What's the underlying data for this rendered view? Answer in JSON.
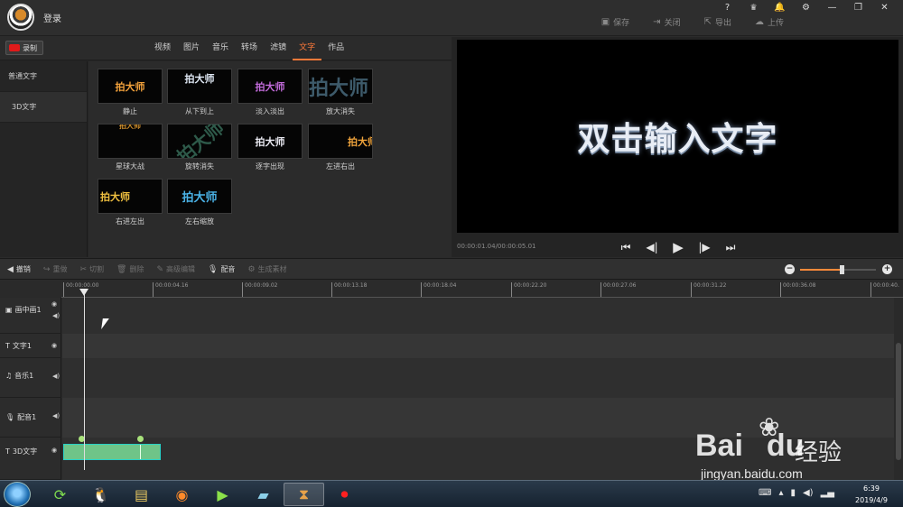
{
  "title_bar": {
    "login": "登录",
    "actions": [
      {
        "icon": "save-icon",
        "label": "保存"
      },
      {
        "icon": "close-doc-icon",
        "label": "关闭"
      },
      {
        "icon": "export-icon",
        "label": "导出"
      },
      {
        "icon": "upload-icon",
        "label": "上传"
      }
    ],
    "window_controls": [
      "?",
      "VIP",
      "🔔",
      "⚙",
      "—",
      "❐",
      "✕"
    ]
  },
  "library": {
    "record_label": "录制",
    "tabs": [
      "视频",
      "图片",
      "音乐",
      "转场",
      "滤镜",
      "文字",
      "作品"
    ],
    "active_tab": "文字",
    "categories": [
      "普通文字",
      "3D文字"
    ],
    "thumb_text": "拍大师",
    "thumbnails": [
      {
        "label": "静止",
        "color": "#f2a13b"
      },
      {
        "label": "从下到上",
        "color": "#dfe8f4"
      },
      {
        "label": "淡入淡出",
        "color": "#c06ad8"
      },
      {
        "label": "放大消失",
        "color": "#3d5a6a"
      },
      {
        "label": "星球大战",
        "color": "#d8942c"
      },
      {
        "label": "旋转消失",
        "color": "#2e5a4a"
      },
      {
        "label": "逐字出现",
        "color": "#e8e8f0"
      },
      {
        "label": "左进右出",
        "color": "#f0a43c"
      },
      {
        "label": "右进左出",
        "color": "#f0c040"
      },
      {
        "label": "左右缩放",
        "color": "#4ab2e6"
      }
    ]
  },
  "preview": {
    "text": "双击输入文字",
    "timecode": "00:00:01.04/00:00:05.01"
  },
  "edit_toolbar": {
    "tools": [
      {
        "icon": "undo-icon",
        "label": "撤销",
        "enabled": true
      },
      {
        "icon": "redo-icon",
        "label": "重做",
        "enabled": false
      },
      {
        "icon": "cut-icon",
        "label": "切割",
        "enabled": false
      },
      {
        "icon": "delete-icon",
        "label": "删除",
        "enabled": false
      },
      {
        "icon": "edit-icon",
        "label": "高级编辑",
        "enabled": false
      },
      {
        "icon": "mic-icon",
        "label": "配音",
        "enabled": true
      },
      {
        "icon": "generate-icon",
        "label": "生成素材",
        "enabled": false
      }
    ],
    "zoom_level": 0.55
  },
  "timeline": {
    "ticks": [
      "00:00:00.00",
      "00:00:04.16",
      "00:00:09.02",
      "00:00:13.18",
      "00:00:18.04",
      "00:00:22.20",
      "00:00:27.06",
      "00:00:31.22",
      "00:00:36.08",
      "00:00:40."
    ],
    "tracks": [
      {
        "name": "画中画1",
        "icon": "pip-icon"
      },
      {
        "name": "文字1",
        "icon": "text-icon"
      },
      {
        "name": "音乐1",
        "icon": "music-icon"
      },
      {
        "name": "配音1",
        "icon": "mic-icon"
      },
      {
        "name": "3D文字",
        "icon": "text-icon"
      }
    ]
  },
  "watermark": {
    "brand": "Bai",
    "brand2": "du",
    "jingyan": "经验",
    "url": "jingyan.baidu.com"
  },
  "taskbar": {
    "time": "6:39",
    "date": "2019/4/9"
  }
}
